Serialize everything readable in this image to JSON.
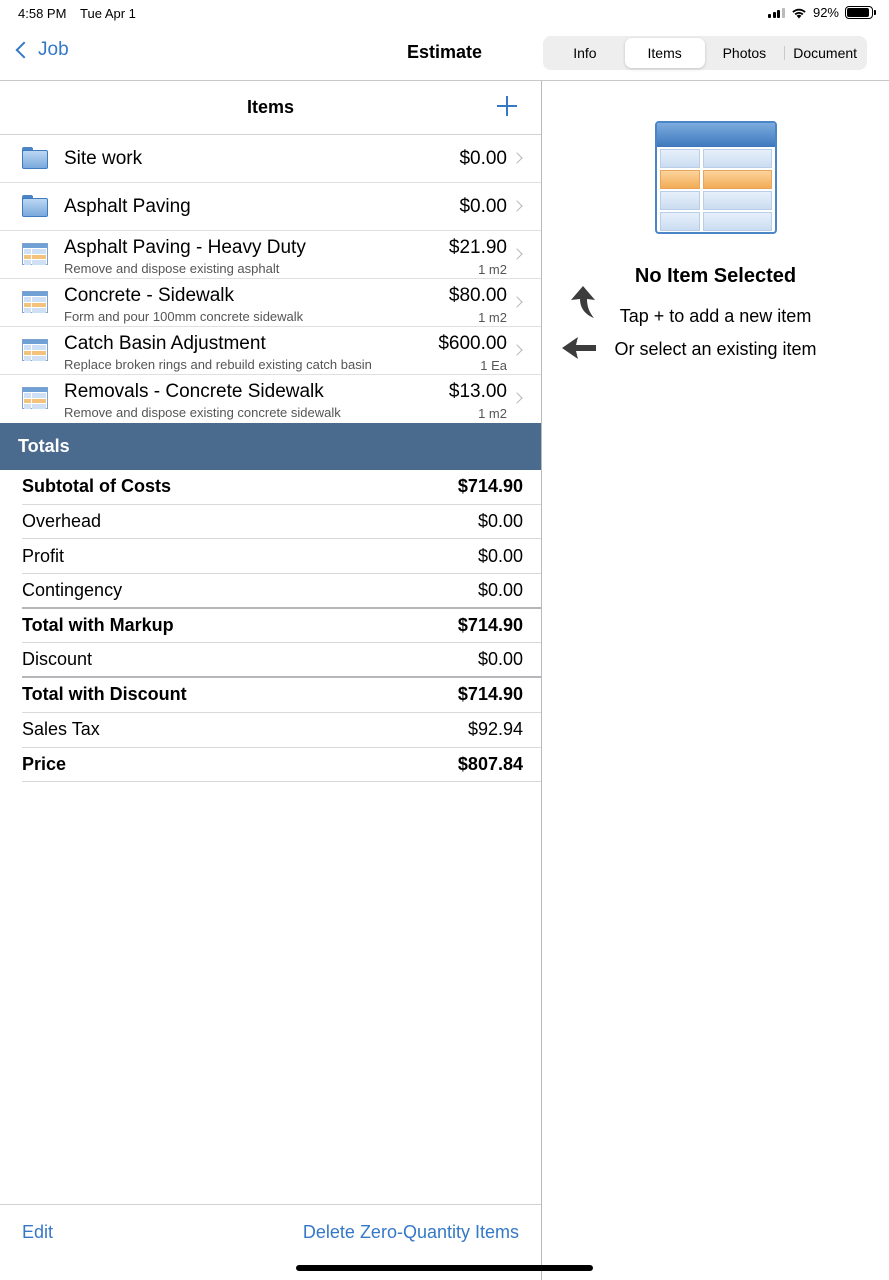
{
  "status_bar": {
    "time": "4:58 PM",
    "date": "Tue Apr 1",
    "battery": "92%",
    "battery_level": 0.92
  },
  "nav": {
    "back_label": "Job",
    "title": "Estimate",
    "tabs": [
      "Info",
      "Items",
      "Photos",
      "Document"
    ],
    "active_tab": "Items"
  },
  "items_panel": {
    "title": "Items",
    "items": [
      {
        "type": "folder",
        "title": "Site work",
        "price": "$0.00"
      },
      {
        "type": "folder",
        "title": "Asphalt Paving",
        "price": "$0.00"
      },
      {
        "type": "item",
        "title": "Asphalt Paving - Heavy Duty",
        "subtitle": "Remove and dispose existing asphalt",
        "price": "$21.90",
        "qty": "1 m2"
      },
      {
        "type": "item",
        "title": "Concrete - Sidewalk",
        "subtitle": "Form and pour 100mm concrete sidewalk",
        "price": "$80.00",
        "qty": "1 m2"
      },
      {
        "type": "item",
        "title": "Catch Basin Adjustment",
        "subtitle": "Replace broken rings and rebuild existing catch basin",
        "price": "$600.00",
        "qty": "1 Ea"
      },
      {
        "type": "item",
        "title": "Removals - Concrete Sidewalk",
        "subtitle": "Remove and dispose existing concrete sidewalk",
        "price": "$13.00",
        "qty": "1 m2"
      }
    ]
  },
  "totals": {
    "header": "Totals",
    "rows": [
      {
        "label": "Subtotal of Costs",
        "value": "$714.90",
        "bold": true
      },
      {
        "label": "Overhead",
        "value": "$0.00",
        "bold": false
      },
      {
        "label": "Profit",
        "value": "$0.00",
        "bold": false
      },
      {
        "label": "Contingency",
        "value": "$0.00",
        "bold": false
      },
      {
        "label": "Total with Markup",
        "value": "$714.90",
        "bold": true
      },
      {
        "label": "Discount",
        "value": "$0.00",
        "bold": false
      },
      {
        "label": "Total with Discount",
        "value": "$714.90",
        "bold": true
      },
      {
        "label": "Sales Tax",
        "value": "$92.94",
        "bold": false
      },
      {
        "label": "Price",
        "value": "$807.84",
        "bold": true
      }
    ]
  },
  "toolbar": {
    "edit_label": "Edit",
    "delete_label": "Delete Zero-Quantity Items"
  },
  "detail": {
    "empty_title": "No Item Selected",
    "hint_add": "Tap + to add a new item",
    "hint_select": "Or select an existing item"
  },
  "colors": {
    "accent": "#3478c6",
    "totals_header": "#4a6b8d"
  }
}
